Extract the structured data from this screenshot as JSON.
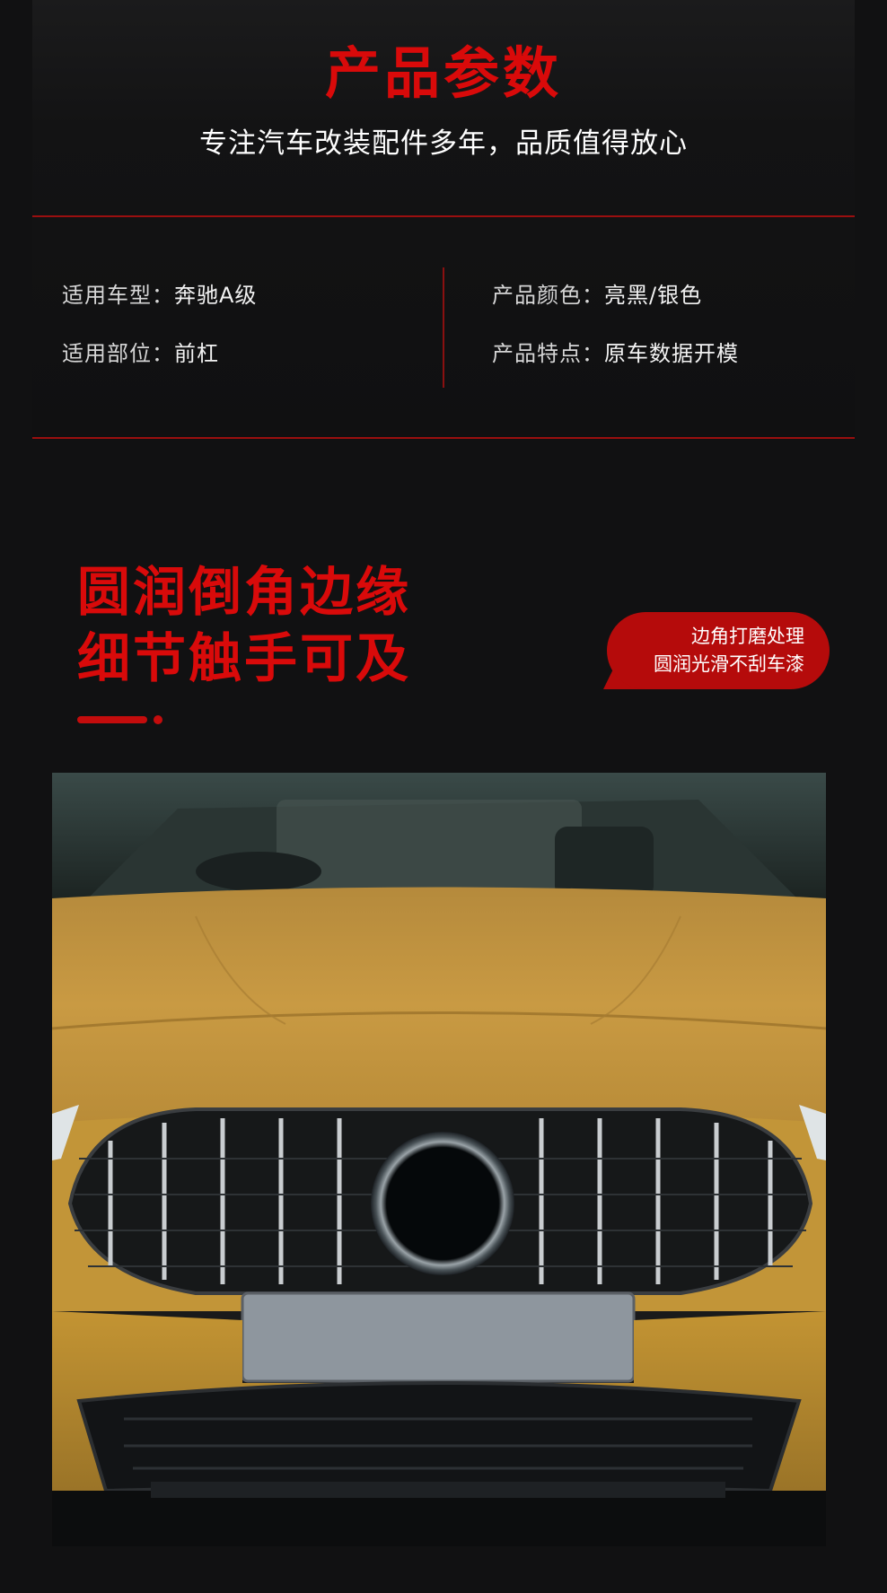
{
  "header": {
    "title": "产品参数",
    "subtitle": "专注汽车改装配件多年，品质值得放心"
  },
  "specs": {
    "car_model": {
      "key": "适用车型：",
      "value": "奔驰A级"
    },
    "position": {
      "key": "适用部位：",
      "value": "前杠"
    },
    "color": {
      "key": "产品颜色：",
      "value": "亮黑/银色"
    },
    "feature": {
      "key": "产品特点：",
      "value": "原车数据开模"
    }
  },
  "detail": {
    "heading_line1": "圆润倒角边缘",
    "heading_line2": "细节触手可及",
    "bubble_line1": "边角打磨处理",
    "bubble_line2": "圆润光滑不刮车漆"
  },
  "photo": {
    "subject": "yellow-car-front-grille-photo"
  },
  "colors": {
    "background": "#111112",
    "accent_red": "#d90a0a",
    "bubble_red": "#b50b0b",
    "car_paint": "#c99a3f"
  }
}
